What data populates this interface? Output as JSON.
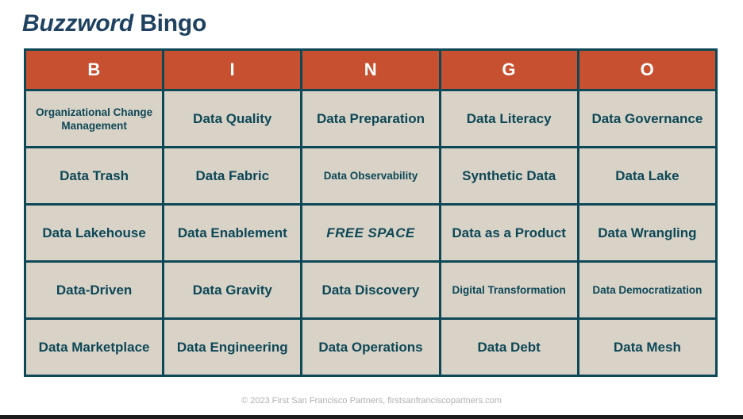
{
  "title": {
    "emphasis": "Buzzword",
    "rest": " Bingo"
  },
  "grid": {
    "headers": [
      "B",
      "I",
      "N",
      "G",
      "O"
    ],
    "rows": [
      [
        {
          "text": "Organizational Change Management",
          "size": "small",
          "free": false
        },
        {
          "text": "Data Quality",
          "size": "large",
          "free": false
        },
        {
          "text": "Data Preparation",
          "size": "large",
          "free": false
        },
        {
          "text": "Data Literacy",
          "size": "large",
          "free": false
        },
        {
          "text": "Data Governance",
          "size": "large",
          "free": false
        }
      ],
      [
        {
          "text": "Data Trash",
          "size": "large",
          "free": false
        },
        {
          "text": "Data Fabric",
          "size": "large",
          "free": false
        },
        {
          "text": "Data Observability",
          "size": "small",
          "free": false
        },
        {
          "text": "Synthetic Data",
          "size": "large",
          "free": false
        },
        {
          "text": "Data Lake",
          "size": "large",
          "free": false
        }
      ],
      [
        {
          "text": "Data Lakehouse",
          "size": "large",
          "free": false
        },
        {
          "text": "Data Enablement",
          "size": "large",
          "free": false
        },
        {
          "text": "FREE SPACE",
          "size": "large",
          "free": true
        },
        {
          "text": "Data as a Product",
          "size": "large",
          "free": false
        },
        {
          "text": "Data Wrangling",
          "size": "large",
          "free": false
        }
      ],
      [
        {
          "text": "Data-Driven",
          "size": "large",
          "free": false
        },
        {
          "text": "Data Gravity",
          "size": "large",
          "free": false
        },
        {
          "text": "Data Discovery",
          "size": "large",
          "free": false
        },
        {
          "text": "Digital Transformation",
          "size": "small",
          "free": false
        },
        {
          "text": "Data Democratization",
          "size": "small",
          "free": false
        }
      ],
      [
        {
          "text": "Data Marketplace",
          "size": "large",
          "free": false
        },
        {
          "text": "Data Engineering",
          "size": "large",
          "free": false
        },
        {
          "text": "Data Operations",
          "size": "large",
          "free": false
        },
        {
          "text": "Data Debt",
          "size": "large",
          "free": false
        },
        {
          "text": "Data Mesh",
          "size": "large",
          "free": false
        }
      ]
    ]
  },
  "footer": {
    "text": "© 2023 First San Francisco Partners, firstsanfranciscopartners.com"
  },
  "colors": {
    "header_fill": "#c6502f",
    "cell_fill": "#d9d2c7",
    "border": "#0d4857",
    "cell_text": "#0d4857",
    "title_text": "#1f4260",
    "free_text": "#c6502f",
    "footer_text": "#b3b0b0"
  }
}
